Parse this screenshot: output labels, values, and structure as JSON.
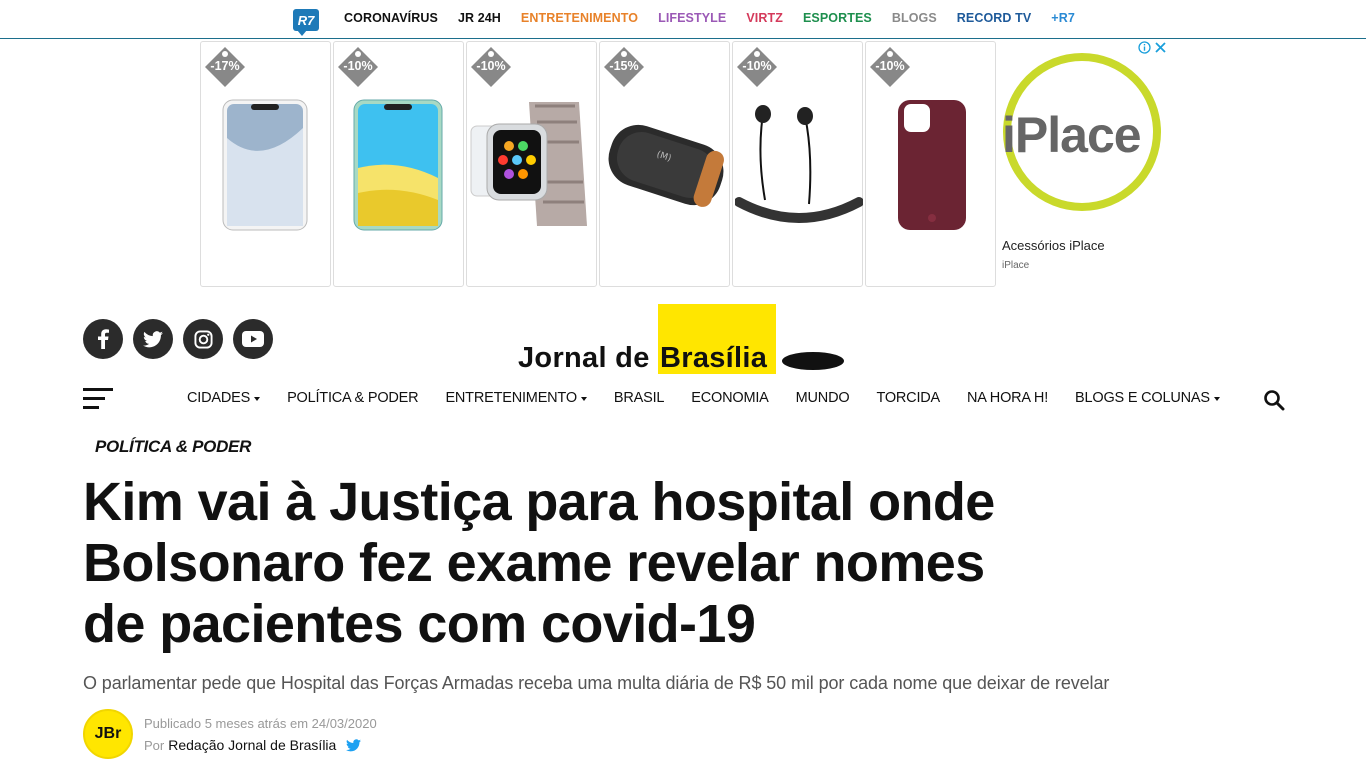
{
  "topbar": {
    "logo_text": "R7",
    "items": [
      {
        "label": "CORONAVÍRUS",
        "color": "#111111"
      },
      {
        "label": "JR 24H",
        "color": "#111111"
      },
      {
        "label": "ENTRETENIMENTO",
        "color": "#e8822a"
      },
      {
        "label": "LIFESTYLE",
        "color": "#9b59b6"
      },
      {
        "label": "VIRTZ",
        "color": "#d43a5b"
      },
      {
        "label": "ESPORTES",
        "color": "#1e8f4e"
      },
      {
        "label": "BLOGS",
        "color": "#8a8a8a"
      },
      {
        "label": "RECORD TV",
        "color": "#1e5a9a"
      },
      {
        "label": "+R7",
        "color": "#2a8ad4"
      }
    ]
  },
  "ad": {
    "discounts": [
      "-17%",
      "-10%",
      "-10%",
      "-15%",
      "-10%",
      "-10%"
    ],
    "brand_logo_text": "iPlace",
    "title": "Acessórios iPlace",
    "advertiser": "iPlace",
    "ring_color": "#c9d92b"
  },
  "logo": {
    "part1": "Jornal de",
    "part2": "Brasília",
    "accent_color": "#ffe600"
  },
  "nav": {
    "items": [
      {
        "label": "CIDADES",
        "dropdown": true
      },
      {
        "label": "POLÍTICA & PODER",
        "dropdown": false
      },
      {
        "label": "ENTRETENIMENTO",
        "dropdown": true
      },
      {
        "label": "BRASIL",
        "dropdown": false
      },
      {
        "label": "ECONOMIA",
        "dropdown": false
      },
      {
        "label": "MUNDO",
        "dropdown": false
      },
      {
        "label": "TORCIDA",
        "dropdown": false
      },
      {
        "label": "NA HORA H!",
        "dropdown": false
      },
      {
        "label": "BLOGS E COLUNAS",
        "dropdown": true
      }
    ]
  },
  "article": {
    "category": "POLÍTICA & PODER",
    "headline": "Kim vai à Justiça para hospital onde Bolsonaro fez exame revelar nomes de pacientes com covid-19",
    "subheadline": "O parlamentar pede que Hospital das Forças Armadas receba uma multa diária de R$ 50 mil por cada nome que deixar de revelar",
    "avatar_text": "JBr",
    "published": "Publicado 5 meses atrás em 24/03/2020",
    "by_prefix": "Por",
    "author": "Redação Jornal de Brasília"
  }
}
